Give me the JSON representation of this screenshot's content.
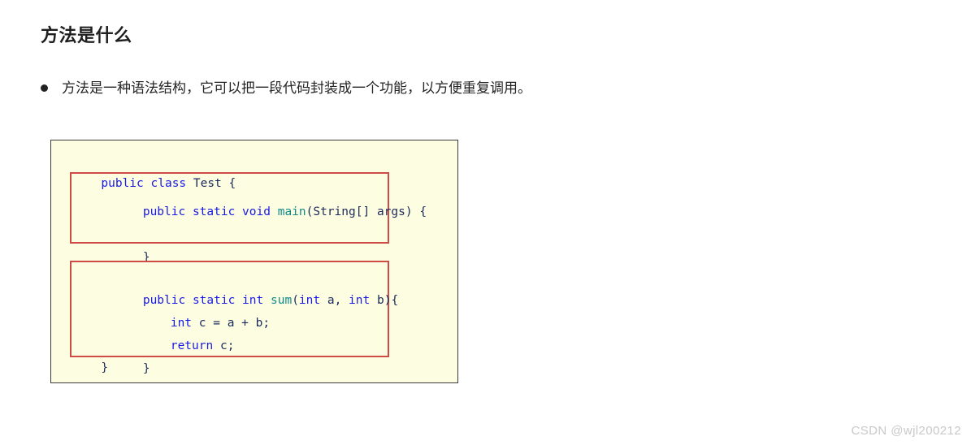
{
  "page": {
    "title": "方法是什么",
    "bullets": [
      "方法是一种语法结构，它可以把一段代码封装成一个功能，以方便重复调用。"
    ],
    "watermark": "CSDN @wjl200212"
  },
  "code_card": {
    "language": "java",
    "background_color": "#fdfde2",
    "border_color": "#3a3a3a",
    "highlight_border_color": "#cf4b45",
    "keyword_color": "#1919e6",
    "method_color": "#128a8a",
    "plain_color": "#1b2a5c",
    "class_line": {
      "keywords": "public class",
      "rest": " Test {"
    },
    "closing_brace": "}",
    "blocks": [
      {
        "name": "main-method",
        "lines": [
          {
            "keywords": "public static void",
            "method": "main",
            "rest": "(String[] args) {"
          },
          {
            "rest": "}"
          }
        ]
      },
      {
        "name": "sum-method",
        "lines": [
          {
            "keywords": "public static int",
            "method": "sum",
            "rest": "(",
            "kw2": "int",
            "rest2": " a, ",
            "kw3": "int",
            "rest3": " b){"
          },
          {
            "keywords": "int",
            "rest": " c = a + b;"
          },
          {
            "keywords": "return",
            "rest": " c;"
          },
          {
            "rest": "}"
          }
        ]
      }
    ]
  }
}
